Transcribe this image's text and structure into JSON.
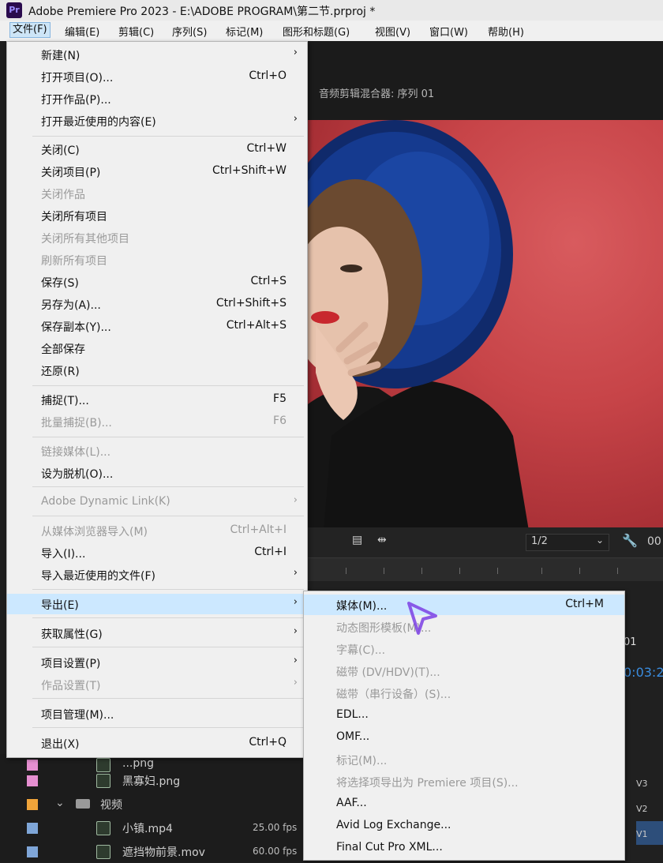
{
  "window": {
    "app_icon": "Pr",
    "title": "Adobe Premiere Pro 2023 - E:\\ADOBE PROGRAM\\第二节.prproj *"
  },
  "menubar": [
    "文件(F)",
    "编辑(E)",
    "剪辑(C)",
    "序列(S)",
    "标记(M)",
    "图形和标题(G)",
    "视图(V)",
    "窗口(W)",
    "帮助(H)"
  ],
  "program_monitor": {
    "title": "音频剪辑混合器: 序列 01",
    "zoom": "1/2",
    "timecode_partial": "00"
  },
  "file_menu": [
    {
      "label": "新建(N)",
      "shortcut": "",
      "submenu": true,
      "disabled": false
    },
    {
      "label": "打开项目(O)...",
      "shortcut": "Ctrl+O",
      "submenu": false,
      "disabled": false
    },
    {
      "label": "打开作品(P)...",
      "shortcut": "",
      "submenu": false,
      "disabled": false
    },
    {
      "label": "打开最近使用的内容(E)",
      "shortcut": "",
      "submenu": true,
      "disabled": false
    },
    {
      "label": "关闭(C)",
      "shortcut": "Ctrl+W",
      "submenu": false,
      "disabled": false
    },
    {
      "label": "关闭项目(P)",
      "shortcut": "Ctrl+Shift+W",
      "submenu": false,
      "disabled": false
    },
    {
      "label": "关闭作品",
      "shortcut": "",
      "submenu": false,
      "disabled": true
    },
    {
      "label": "关闭所有项目",
      "shortcut": "",
      "submenu": false,
      "disabled": false
    },
    {
      "label": "关闭所有其他项目",
      "shortcut": "",
      "submenu": false,
      "disabled": true
    },
    {
      "label": "刷新所有项目",
      "shortcut": "",
      "submenu": false,
      "disabled": true
    },
    {
      "label": "保存(S)",
      "shortcut": "Ctrl+S",
      "submenu": false,
      "disabled": false
    },
    {
      "label": "另存为(A)...",
      "shortcut": "Ctrl+Shift+S",
      "submenu": false,
      "disabled": false
    },
    {
      "label": "保存副本(Y)...",
      "shortcut": "Ctrl+Alt+S",
      "submenu": false,
      "disabled": false
    },
    {
      "label": "全部保存",
      "shortcut": "",
      "submenu": false,
      "disabled": false
    },
    {
      "label": "还原(R)",
      "shortcut": "",
      "submenu": false,
      "disabled": false
    },
    {
      "label": "捕捉(T)...",
      "shortcut": "F5",
      "submenu": false,
      "disabled": false
    },
    {
      "label": "批量捕捉(B)...",
      "shortcut": "F6",
      "submenu": false,
      "disabled": true
    },
    {
      "label": "链接媒体(L)...",
      "shortcut": "",
      "submenu": false,
      "disabled": true
    },
    {
      "label": "设为脱机(O)...",
      "shortcut": "",
      "submenu": false,
      "disabled": false
    },
    {
      "label": "Adobe Dynamic Link(K)",
      "shortcut": "",
      "submenu": true,
      "disabled": true
    },
    {
      "label": "从媒体浏览器导入(M)",
      "shortcut": "Ctrl+Alt+I",
      "submenu": false,
      "disabled": true
    },
    {
      "label": "导入(I)...",
      "shortcut": "Ctrl+I",
      "submenu": false,
      "disabled": false
    },
    {
      "label": "导入最近使用的文件(F)",
      "shortcut": "",
      "submenu": true,
      "disabled": false
    },
    {
      "label": "导出(E)",
      "shortcut": "",
      "submenu": true,
      "disabled": false,
      "highlighted": true
    },
    {
      "label": "获取属性(G)",
      "shortcut": "",
      "submenu": true,
      "disabled": false
    },
    {
      "label": "项目设置(P)",
      "shortcut": "",
      "submenu": true,
      "disabled": false
    },
    {
      "label": "作品设置(T)",
      "shortcut": "",
      "submenu": true,
      "disabled": true
    },
    {
      "label": "项目管理(M)...",
      "shortcut": "",
      "submenu": false,
      "disabled": false
    },
    {
      "label": "退出(X)",
      "shortcut": "Ctrl+Q",
      "submenu": false,
      "disabled": false
    }
  ],
  "export_submenu": [
    {
      "label": "媒体(M)...",
      "shortcut": "Ctrl+M",
      "disabled": false,
      "highlighted": true
    },
    {
      "label": "动态图形模板(M)...",
      "shortcut": "",
      "disabled": true
    },
    {
      "label": "字幕(C)...",
      "shortcut": "",
      "disabled": true
    },
    {
      "label": "磁带 (DV/HDV)(T)...",
      "shortcut": "",
      "disabled": true
    },
    {
      "label": "磁带（串行设备）(S)...",
      "shortcut": "",
      "disabled": true
    },
    {
      "label": "EDL...",
      "shortcut": "",
      "disabled": false
    },
    {
      "label": "OMF...",
      "shortcut": "",
      "disabled": false
    },
    {
      "label": "标记(M)...",
      "shortcut": "",
      "disabled": true
    },
    {
      "label": "将选择项导出为 Premiere 项目(S)...",
      "shortcut": "",
      "disabled": true
    },
    {
      "label": "AAF...",
      "shortcut": "",
      "disabled": false
    },
    {
      "label": "Avid Log Exchange...",
      "shortcut": "",
      "disabled": false
    },
    {
      "label": "Final Cut Pro XML...",
      "shortcut": "",
      "disabled": false
    }
  ],
  "project_items": [
    {
      "name": "...png",
      "fps": "",
      "color": "#e58fd0",
      "indent": 1
    },
    {
      "name": "黑寡妇.png",
      "fps": "",
      "color": "#e58fd0",
      "indent": 1
    },
    {
      "name": "视频",
      "fps": "",
      "color": "#f0a43a",
      "indent": 0,
      "folder": true
    },
    {
      "name": "小镇.mp4",
      "fps": "25.00 fps",
      "color": "#7fa6d8",
      "indent": 1
    },
    {
      "name": "遮挡物前景.mov",
      "fps": "60.00 fps",
      "color": "#7fa6d8",
      "indent": 1
    }
  ],
  "timeline": {
    "tab": "01",
    "timecode": "0:03:2",
    "tracks": [
      "V3",
      "V2",
      "V1"
    ]
  }
}
